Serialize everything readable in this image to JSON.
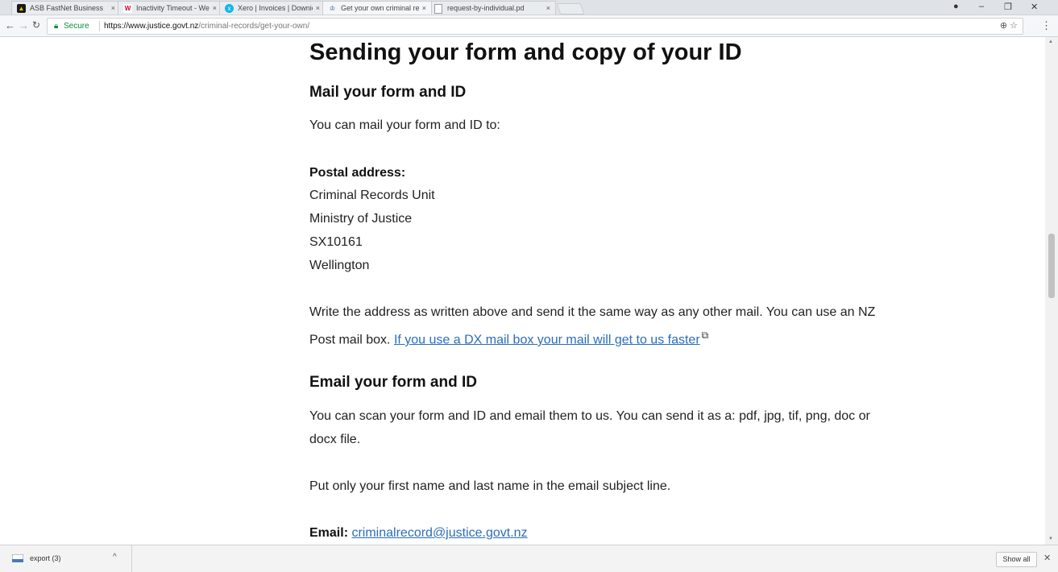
{
  "browser": {
    "tabs": [
      {
        "title": "ASB FastNet Business",
        "favicon": "asb-icon",
        "color": "#1a1a1a"
      },
      {
        "title": "Inactivity Timeout - Wes",
        "favicon": "westpac-icon",
        "color": "#d5002b"
      },
      {
        "title": "Xero | Invoices | Downie",
        "favicon": "xero-icon",
        "color": "#13b5ea"
      },
      {
        "title": "Get your own criminal re",
        "favicon": "justice-icon",
        "color": "#1f4e8c"
      },
      {
        "title": "request-by-individual.pd",
        "favicon": "document-icon",
        "color": "#888888"
      }
    ],
    "address": {
      "secure_label": "Secure",
      "url_host": "https://www.justice.govt.nz",
      "url_path": "/criminal-records/get-your-own/"
    }
  },
  "page": {
    "heading": "Sending your form and copy of your ID",
    "mail_section": {
      "heading": "Mail your form and ID",
      "intro": "You can mail your form and ID to:",
      "postal_label": "Postal address:",
      "address_lines": [
        "Criminal Records Unit",
        "Ministry of Justice",
        "SX10161",
        "Wellington"
      ],
      "instruction_line1": "Write the address as written above and send it the same way as any other mail. You can use an NZ",
      "instruction_line2_prefix": "Post mail box. ",
      "dx_link": "If you use a DX mail box your mail will get to us faster"
    },
    "email_section": {
      "heading": "Email your form and ID",
      "line1": "You can scan your form and ID and email them to us. You can send it as a: pdf, jpg, tif, png, doc or",
      "line2": "docx file.",
      "subject_note": "Put only your first name and last name in the email subject line.",
      "email_label": "Email:",
      "email_address": "criminalrecord@justice.govt.nz"
    }
  },
  "downloads": {
    "file_name": "export (3)",
    "show_all": "Show all"
  },
  "colors": {
    "link": "#2a6ebb",
    "secure": "#0a8a3a"
  }
}
